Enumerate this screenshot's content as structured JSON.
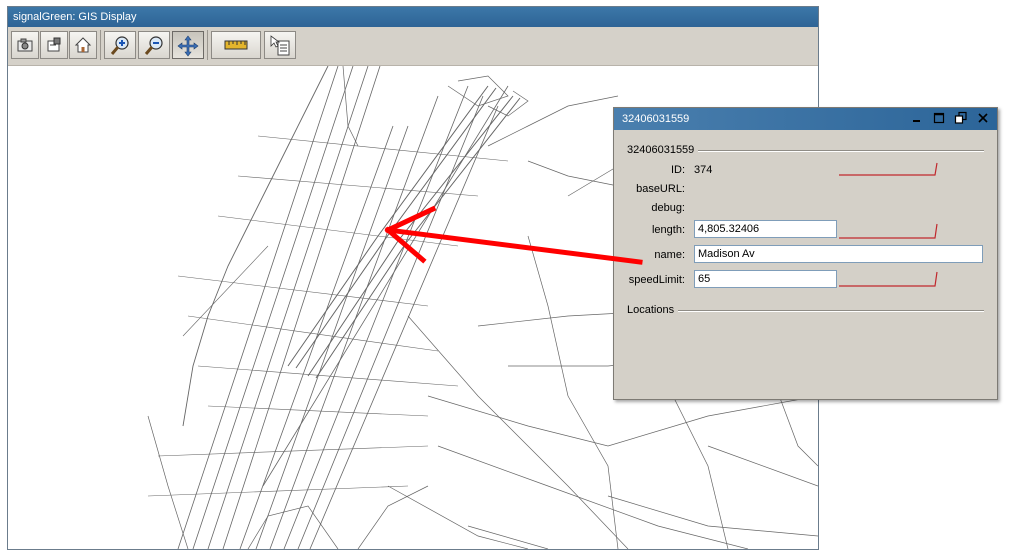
{
  "window": {
    "title": "signalGreen: GIS Display"
  },
  "toolbar": {
    "buttons": [
      {
        "icon": "camera-icon"
      },
      {
        "icon": "export-icon"
      },
      {
        "icon": "home-icon"
      },
      {
        "icon": "zoom-in-icon"
      },
      {
        "icon": "zoom-out-icon"
      },
      {
        "icon": "pan-icon",
        "pressed": true
      },
      {
        "icon": "measure-ruler-icon"
      },
      {
        "icon": "select-info-icon"
      }
    ]
  },
  "dialog": {
    "title": "32406031559",
    "group_title": "32406031559",
    "fields": {
      "id": {
        "label": "ID:",
        "value": "374"
      },
      "base_url": {
        "label": "baseURL:"
      },
      "debug": {
        "label": "debug:"
      },
      "length": {
        "label": "length:",
        "value": "4,805.32406"
      },
      "name": {
        "label": "name:",
        "value": "Madison Av"
      },
      "speed_limit": {
        "label": "speedLimit:",
        "value": "65"
      }
    },
    "locations_label": "Locations"
  },
  "colors": {
    "titlebar": "#2e6496",
    "arrow": "#ff0000",
    "dialog_bg": "#d4d0c8",
    "road": "#666666"
  }
}
